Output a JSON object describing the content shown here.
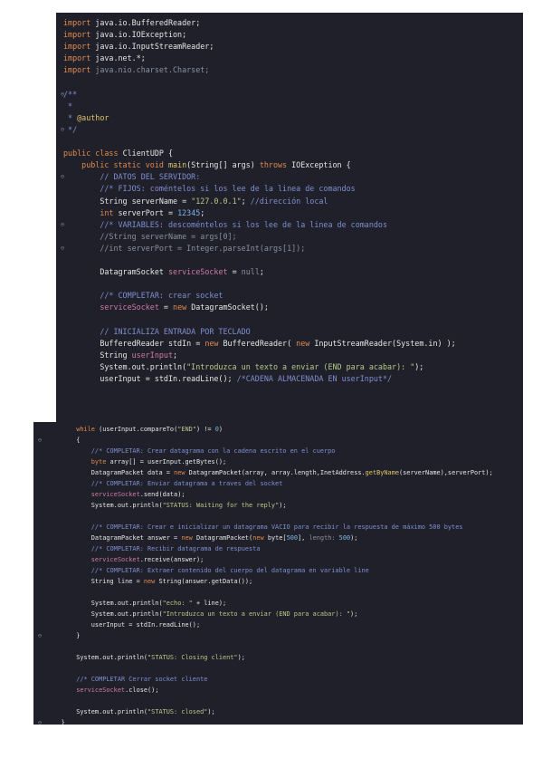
{
  "editor_top": {
    "lines": [
      {
        "fold": "",
        "segs": [
          [
            "kw",
            "import "
          ],
          [
            "cls",
            "java.io.BufferedReader;"
          ]
        ]
      },
      {
        "fold": "",
        "segs": [
          [
            "kw",
            "import "
          ],
          [
            "cls",
            "java.io.IOException;"
          ]
        ]
      },
      {
        "fold": "",
        "segs": [
          [
            "kw",
            "import "
          ],
          [
            "cls",
            "java.io.InputStreamReader;"
          ]
        ]
      },
      {
        "fold": "",
        "segs": [
          [
            "kw",
            "import "
          ],
          [
            "cls",
            "java.net.*;"
          ]
        ]
      },
      {
        "fold": "",
        "segs": [
          [
            "kw",
            "import "
          ],
          [
            "grey",
            "java.nio.charset.Charset;"
          ]
        ]
      },
      {
        "fold": "",
        "segs": []
      },
      {
        "fold": "⊖",
        "segs": [
          [
            "cm",
            "/**"
          ]
        ]
      },
      {
        "fold": "",
        "segs": [
          [
            "cm",
            " *"
          ]
        ]
      },
      {
        "fold": "",
        "segs": [
          [
            "cm",
            " * "
          ],
          [
            "fn",
            "@author"
          ],
          [
            "cm",
            " "
          ]
        ]
      },
      {
        "fold": "⊖",
        "segs": [
          [
            "cm",
            " */"
          ]
        ]
      },
      {
        "fold": "",
        "segs": []
      },
      {
        "fold": "",
        "segs": [
          [
            "kw",
            "public class "
          ],
          [
            "cls",
            "ClientUDP {"
          ]
        ]
      },
      {
        "fold": "",
        "segs": [
          [
            "kw",
            "    public static void "
          ],
          [
            "fn",
            "main"
          ],
          [
            "cls",
            "(String[] args) "
          ],
          [
            "kw",
            "throws "
          ],
          [
            "cls",
            "IOException {"
          ]
        ]
      },
      {
        "fold": "⊖",
        "segs": [
          [
            "cm",
            "        // DATOS DEL SERVIDOR:"
          ]
        ]
      },
      {
        "fold": "",
        "segs": [
          [
            "cm",
            "        //* FIJOS: coméntelos si los lee de la linea de comandos"
          ]
        ]
      },
      {
        "fold": "",
        "segs": [
          [
            "cls",
            "        String serverName = "
          ],
          [
            "str",
            "\"127.0.0.1\""
          ],
          [
            "cls",
            "; "
          ],
          [
            "cm",
            "//dirección local"
          ]
        ]
      },
      {
        "fold": "",
        "segs": [
          [
            "kw",
            "        int "
          ],
          [
            "cls",
            "serverPort = "
          ],
          [
            "num",
            "12345"
          ],
          [
            "cls",
            ";"
          ]
        ]
      },
      {
        "fold": "⊖",
        "segs": [
          [
            "cm",
            "        //* VARIABLES: descoméntelos si los lee de la linea de comandos"
          ]
        ]
      },
      {
        "fold": "",
        "segs": [
          [
            "grey",
            "        //String serverName = args[0];"
          ]
        ]
      },
      {
        "fold": "⊖",
        "segs": [
          [
            "grey",
            "        //int serverPort = Integer.parseInt(args[1]);"
          ]
        ]
      },
      {
        "fold": "",
        "segs": []
      },
      {
        "fold": "",
        "segs": [
          [
            "cls",
            "        DatagramSocket "
          ],
          [
            "fld",
            "serviceSocket"
          ],
          [
            "cls",
            " = "
          ],
          [
            "grey",
            "null"
          ],
          [
            "cls",
            ";"
          ]
        ]
      },
      {
        "fold": "",
        "segs": []
      },
      {
        "fold": "",
        "segs": [
          [
            "cm",
            "        //* COMPLETAR: crear socket"
          ]
        ]
      },
      {
        "fold": "",
        "segs": [
          [
            "fld",
            "        serviceSocket"
          ],
          [
            "cls",
            " = "
          ],
          [
            "kw",
            "new "
          ],
          [
            "cls",
            "DatagramSocket();"
          ]
        ]
      },
      {
        "fold": "",
        "segs": []
      },
      {
        "fold": "",
        "segs": [
          [
            "cm",
            "        // INICIALIZA ENTRADA POR TECLADO"
          ]
        ]
      },
      {
        "fold": "",
        "segs": [
          [
            "cls",
            "        BufferedReader stdIn = "
          ],
          [
            "kw",
            "new "
          ],
          [
            "cls",
            "BufferedReader( "
          ],
          [
            "kw",
            "new "
          ],
          [
            "cls",
            "InputStreamReader(System.in) );"
          ]
        ]
      },
      {
        "fold": "",
        "segs": [
          [
            "cls",
            "        String "
          ],
          [
            "fld",
            "userInput"
          ],
          [
            "cls",
            ";"
          ]
        ]
      },
      {
        "fold": "",
        "segs": [
          [
            "cls",
            "        System.out.println("
          ],
          [
            "str",
            "\"Introduzca un texto a enviar (END para acabar): \""
          ],
          [
            "cls",
            ");"
          ]
        ]
      },
      {
        "fold": "",
        "segs": [
          [
            "cls",
            "        userInput = stdIn.readLine(); "
          ],
          [
            "cm",
            "/*CADENA ALMACENADA EN userInput*/"
          ]
        ]
      },
      {
        "fold": "",
        "segs": []
      }
    ]
  },
  "editor_bottom": {
    "lines": [
      {
        "fold": "",
        "segs": [
          [
            "kw",
            "        while "
          ],
          [
            "cls",
            "(userInput.compareTo("
          ],
          [
            "str",
            "\"END\""
          ],
          [
            "cls",
            ") != "
          ],
          [
            "num",
            "0"
          ],
          [
            "cls",
            ")"
          ]
        ]
      },
      {
        "fold": "⊖",
        "segs": [
          [
            "cls",
            "        {"
          ]
        ]
      },
      {
        "fold": "",
        "segs": [
          [
            "cm",
            "            //* COMPLETAR: Crear datagrama con la cadena escrito en el cuerpo"
          ]
        ]
      },
      {
        "fold": "",
        "segs": [
          [
            "kw",
            "            byte "
          ],
          [
            "cls",
            "array[] = userInput.getBytes();"
          ]
        ]
      },
      {
        "fold": "",
        "segs": [
          [
            "cls",
            "            DatagramPacket data = "
          ],
          [
            "kw",
            "new "
          ],
          [
            "cls",
            "DatagramPacket(array, array.length,InetAddress."
          ],
          [
            "fn",
            "getByName"
          ],
          [
            "cls",
            "(serverName),serverPort);"
          ]
        ]
      },
      {
        "fold": "",
        "segs": [
          [
            "cm",
            "            //* COMPLETAR: Enviar datagrama a traves del socket"
          ]
        ]
      },
      {
        "fold": "",
        "segs": [
          [
            "fld",
            "            serviceSocket"
          ],
          [
            "cls",
            ".send(data);"
          ]
        ]
      },
      {
        "fold": "",
        "segs": [
          [
            "cls",
            "            System.out.println("
          ],
          [
            "str",
            "\"STATUS: Waiting for the reply\""
          ],
          [
            "cls",
            ");"
          ]
        ]
      },
      {
        "fold": "",
        "segs": []
      },
      {
        "fold": "",
        "segs": [
          [
            "cm",
            "            //* COMPLETAR: Crear e inicializar un datagrama VACIO para recibir la respuesta de máximo 500 bytes"
          ]
        ]
      },
      {
        "fold": "",
        "segs": [
          [
            "cls",
            "            DatagramPacket answer = "
          ],
          [
            "kw",
            "new "
          ],
          [
            "cls",
            "DatagramPacket("
          ],
          [
            "kw",
            "new "
          ],
          [
            "cls",
            "byte["
          ],
          [
            "num",
            "500"
          ],
          [
            "cls",
            "], "
          ],
          [
            "grey",
            "length: "
          ],
          [
            "num",
            "500"
          ],
          [
            "cls",
            ");"
          ]
        ]
      },
      {
        "fold": "",
        "segs": [
          [
            "cm",
            "            //* COMPLETAR: Recibir datagrama de respuesta"
          ]
        ]
      },
      {
        "fold": "",
        "segs": [
          [
            "fld",
            "            serviceSocket"
          ],
          [
            "cls",
            ".receive(answer);"
          ]
        ]
      },
      {
        "fold": "",
        "segs": [
          [
            "cm",
            "            //* COMPLETAR: Extraer contenido del cuerpo del datagrama en variable line"
          ]
        ]
      },
      {
        "fold": "",
        "segs": [
          [
            "cls",
            "            String line = "
          ],
          [
            "kw",
            "new "
          ],
          [
            "cls",
            "String(answer.getData());"
          ]
        ]
      },
      {
        "fold": "",
        "segs": []
      },
      {
        "fold": "",
        "segs": [
          [
            "cls",
            "            System.out.println("
          ],
          [
            "str",
            "\"echo: \""
          ],
          [
            "cls",
            " + line);"
          ]
        ]
      },
      {
        "fold": "",
        "segs": [
          [
            "cls",
            "            System.out.println("
          ],
          [
            "str",
            "\"Introduzca un texto a enviar (END para acabar): \""
          ],
          [
            "cls",
            ");"
          ]
        ]
      },
      {
        "fold": "",
        "segs": [
          [
            "cls",
            "            userInput = stdIn.readLine();"
          ]
        ]
      },
      {
        "fold": "⊖",
        "segs": [
          [
            "cls",
            "        }"
          ]
        ]
      },
      {
        "fold": "",
        "segs": []
      },
      {
        "fold": "",
        "segs": [
          [
            "cls",
            "        System.out.println("
          ],
          [
            "str",
            "\"STATUS: Closing client\""
          ],
          [
            "cls",
            ");"
          ]
        ]
      },
      {
        "fold": "",
        "segs": []
      },
      {
        "fold": "",
        "segs": [
          [
            "cm",
            "        //* COMPLETAR Cerrar socket cliente"
          ]
        ]
      },
      {
        "fold": "",
        "segs": [
          [
            "fld",
            "        serviceSocket"
          ],
          [
            "cls",
            ".close();"
          ]
        ]
      },
      {
        "fold": "",
        "segs": []
      },
      {
        "fold": "",
        "segs": [
          [
            "cls",
            "        System.out.println("
          ],
          [
            "str",
            "\"STATUS: closed\""
          ],
          [
            "cls",
            ");"
          ]
        ]
      },
      {
        "fold": "⊖",
        "segs": [
          [
            "cls",
            "    }"
          ]
        ]
      },
      {
        "fold": "",
        "segs": [
          [
            "cls",
            "}"
          ]
        ]
      }
    ]
  }
}
